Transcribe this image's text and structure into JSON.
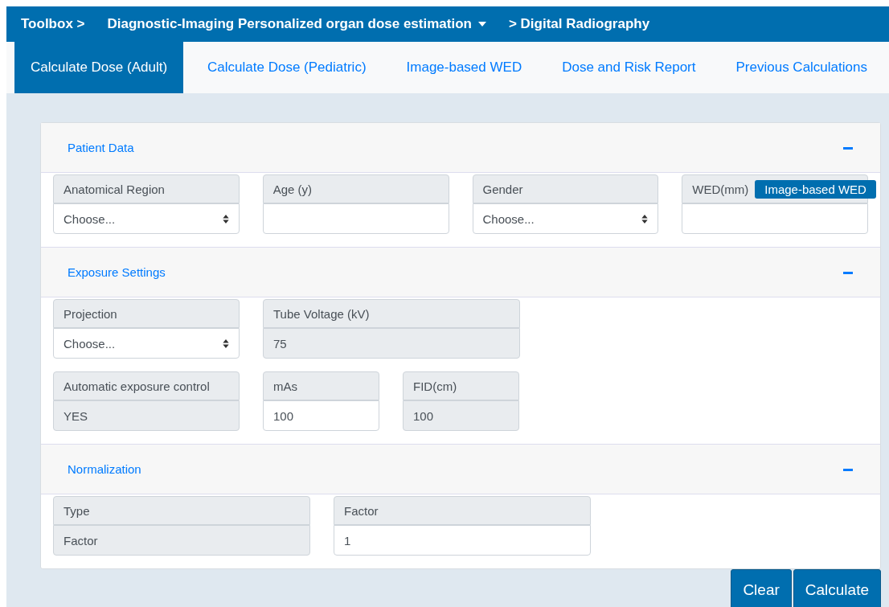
{
  "breadcrumb": [
    {
      "label": "Toolbox >",
      "dropdown": false
    },
    {
      "label": "Diagnostic-Imaging Personalized organ dose estimation",
      "dropdown": true
    },
    {
      "label": "> Digital Radiography",
      "dropdown": false
    }
  ],
  "tabs": [
    {
      "label": "Calculate Dose (Adult)",
      "selected": true
    },
    {
      "label": "Calculate Dose (Pediatric)",
      "selected": false
    },
    {
      "label": "Image-based WED",
      "selected": false
    },
    {
      "label": "Dose and Risk Report",
      "selected": false
    },
    {
      "label": "Previous Calculations",
      "selected": false
    }
  ],
  "sections": [
    {
      "title": "Patient Data",
      "expanded": true,
      "rows": [
        [
          {
            "label": "Anatomical Region",
            "kind": "select",
            "value": "Choose..."
          },
          {
            "label": "Age (y)",
            "kind": "input"
          },
          {
            "label": "Gender",
            "kind": "select",
            "value": "Choose..."
          },
          {
            "label": "WED(mm)",
            "kind": "input",
            "button": "Image-based WED"
          }
        ]
      ]
    },
    {
      "title": "Exposure Settings",
      "expanded": true,
      "rows": [
        [
          {
            "label": "Projection",
            "kind": "select",
            "value": "Choose..."
          },
          {
            "label": "Tube Voltage (kV)",
            "kind": "readonly",
            "value": "75"
          }
        ],
        [
          {
            "label": "Automatic exposure control",
            "kind": "readonly",
            "value": "YES"
          },
          {
            "label": "mAs",
            "kind": "input",
            "value": "100"
          },
          {
            "label": "FID(cm)",
            "kind": "readonly",
            "value": "100"
          }
        ]
      ]
    },
    {
      "title": "Normalization",
      "expanded": true,
      "rows": [
        [
          {
            "label": "Type",
            "kind": "readonly",
            "value": "Factor"
          },
          {
            "label": "Factor",
            "kind": "input",
            "value": "1"
          }
        ]
      ]
    }
  ],
  "buttons": [
    "Clear",
    "Calculate"
  ]
}
